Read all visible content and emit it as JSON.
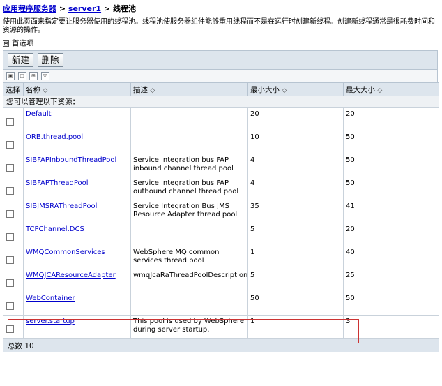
{
  "breadcrumb": {
    "root": "应用程序服务器",
    "sep1": ">",
    "server": "server1",
    "sep2": ">",
    "current": "线程池"
  },
  "description": "使用此页面来指定要让服务器使用的线程池。线程池使服务器组件能够重用线程而不是在运行时创建新线程。创建新线程通常是很耗费时间和资源的操作。",
  "preferences": {
    "toggle": "⊟",
    "label": "首选项"
  },
  "toolbar": {
    "new_label": "新建",
    "delete_label": "删除"
  },
  "table": {
    "headers": {
      "select": "选择",
      "name": "名称",
      "description": "描述",
      "min": "最小大小",
      "max": "最大大小"
    },
    "sort_glyph": "◇",
    "banner": "您可以管理以下资源：",
    "rows": [
      {
        "name": "Default",
        "description": "",
        "min": "20",
        "max": "20"
      },
      {
        "name": "ORB.thread.pool",
        "description": "",
        "min": "10",
        "max": "50"
      },
      {
        "name": "SIBFAPInboundThreadPool",
        "description": "Service integration bus FAP inbound channel thread pool",
        "min": "4",
        "max": "50"
      },
      {
        "name": "SIBFAPThreadPool",
        "description": "Service integration bus FAP outbound channel thread pool",
        "min": "4",
        "max": "50"
      },
      {
        "name": "SIBJMSRAThreadPool",
        "description": "Service Integration Bus JMS Resource Adapter thread pool",
        "min": "35",
        "max": "41"
      },
      {
        "name": "TCPChannel.DCS",
        "description": "",
        "min": "5",
        "max": "20"
      },
      {
        "name": "WMQCommonServices",
        "description": "WebSphere MQ common services thread pool",
        "min": "1",
        "max": "40"
      },
      {
        "name": "WMQJCAResourceAdapter",
        "description": "wmqJcaRaThreadPoolDescription",
        "min": "5",
        "max": "25"
      },
      {
        "name": "WebContainer",
        "description": "",
        "min": "50",
        "max": "50"
      },
      {
        "name": "server.startup",
        "description": "This pool is used by WebSphere during server startup.",
        "min": "1",
        "max": "3"
      }
    ],
    "footer_label": "总数",
    "footer_count": "10"
  },
  "highlight_color": "#cc3333"
}
